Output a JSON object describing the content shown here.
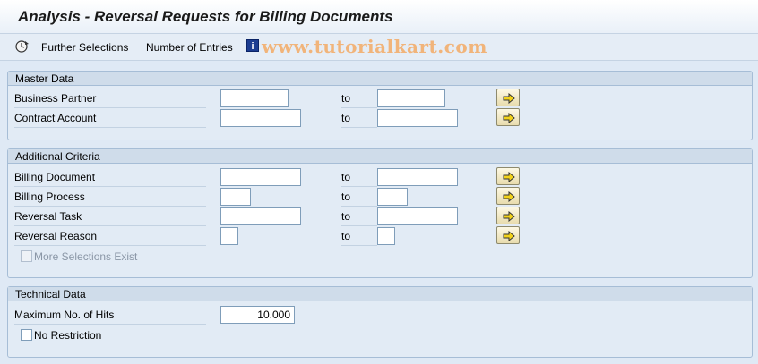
{
  "window": {
    "title": "Analysis - Reversal Requests for Billing Documents"
  },
  "toolbar": {
    "execute_icon": "execute-clock-icon",
    "further_selections": "Further Selections",
    "number_of_entries": "Number of Entries",
    "info_icon_glyph": "i",
    "watermark": "www.tutorialkart.com"
  },
  "master_data": {
    "header": "Master Data",
    "rows": [
      {
        "label": "Business Partner",
        "to": "to",
        "from_value": "",
        "to_value": ""
      },
      {
        "label": "Contract Account",
        "to": "to",
        "from_value": "",
        "to_value": ""
      }
    ]
  },
  "additional_criteria": {
    "header": "Additional Criteria",
    "rows": [
      {
        "label": "Billing Document",
        "to": "to",
        "from_value": "",
        "to_value": ""
      },
      {
        "label": "Billing Process",
        "to": "to",
        "from_value": "",
        "to_value": ""
      },
      {
        "label": "Reversal Task",
        "to": "to",
        "from_value": "",
        "to_value": ""
      },
      {
        "label": "Reversal Reason",
        "to": "to",
        "from_value": "",
        "to_value": ""
      }
    ],
    "more_selections": "More Selections Exist"
  },
  "technical_data": {
    "header": "Technical Data",
    "max_hits_label": "Maximum No. of Hits",
    "max_hits_value": "10.000",
    "no_restriction": "No Restriction"
  },
  "colors": {
    "background": "#dfe9f5",
    "group_header": "#cfdcea",
    "arrow_button": "#f3e9c0",
    "watermark": "#f1b47a",
    "info_icon": "#1c3d91"
  }
}
